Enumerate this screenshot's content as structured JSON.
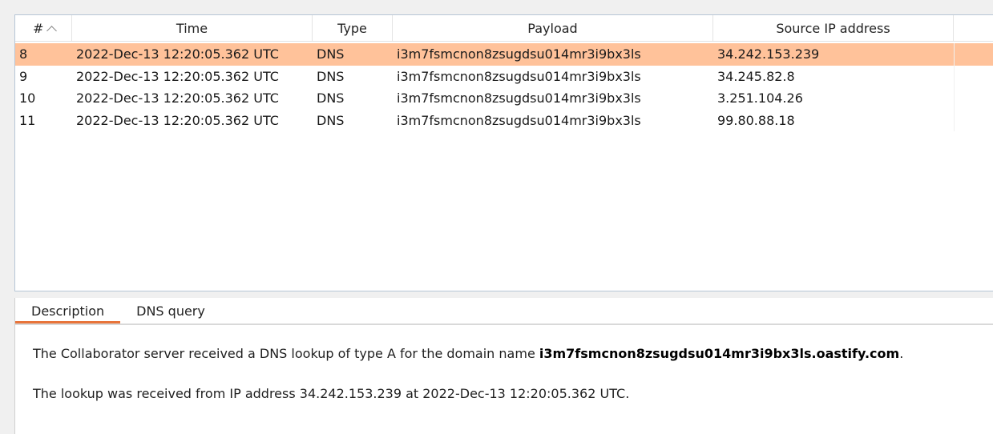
{
  "table": {
    "columns": {
      "num": "#",
      "time": "Time",
      "type": "Type",
      "payload": "Payload",
      "source_ip": "Source IP address"
    },
    "sort": {
      "column": "#",
      "direction": "ascending"
    },
    "rows": [
      {
        "num": "8",
        "time": "2022-Dec-13 12:20:05.362 UTC",
        "type": "DNS",
        "payload": "i3m7fsmcnon8zsugdsu014mr3i9bx3ls",
        "source_ip": "34.242.153.239",
        "selected": true
      },
      {
        "num": "9",
        "time": "2022-Dec-13 12:20:05.362 UTC",
        "type": "DNS",
        "payload": "i3m7fsmcnon8zsugdsu014mr3i9bx3ls",
        "source_ip": "34.245.82.8",
        "selected": false
      },
      {
        "num": "10",
        "time": "2022-Dec-13 12:20:05.362 UTC",
        "type": "DNS",
        "payload": "i3m7fsmcnon8zsugdsu014mr3i9bx3ls",
        "source_ip": "3.251.104.26",
        "selected": false
      },
      {
        "num": "11",
        "time": "2022-Dec-13 12:20:05.362 UTC",
        "type": "DNS",
        "payload": "i3m7fsmcnon8zsugdsu014mr3i9bx3ls",
        "source_ip": "99.80.88.18",
        "selected": false
      }
    ]
  },
  "details": {
    "tabs": [
      "Description",
      "DNS query"
    ],
    "active_tab": "Description",
    "line1_prefix": "The Collaborator server received a DNS lookup of type A for the domain name ",
    "line1_domain": "i3m7fsmcnon8zsugdsu014mr3i9bx3ls.oastify.com",
    "line1_suffix": ".",
    "line2": "The lookup was received from IP address 34.242.153.239 at 2022-Dec-13 12:20:05.362 UTC."
  },
  "colors": {
    "selected_row": "#ffc29a",
    "active_tab_underline": "#e8743b"
  }
}
